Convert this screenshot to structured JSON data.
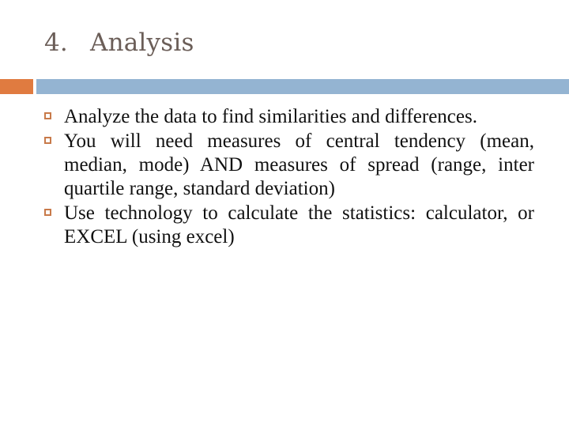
{
  "slide": {
    "title_number": "4.",
    "title_text": "Analysis",
    "accent_colors": {
      "orange": "#e07b40",
      "blue": "#94b4d2",
      "title": "#6b5e58",
      "bullet": "#c87a4a"
    },
    "bullet_icon": "square-outline-icon",
    "bullets": [
      {
        "text": "Analyze the data to find similarities and differences."
      },
      {
        "text": "You will need measures of central tendency (mean, median, mode) AND measures of spread (range, inter quartile range, standard deviation)"
      },
      {
        "text": "Use technology to calculate the statistics: calculator, or EXCEL (using excel)"
      }
    ]
  }
}
